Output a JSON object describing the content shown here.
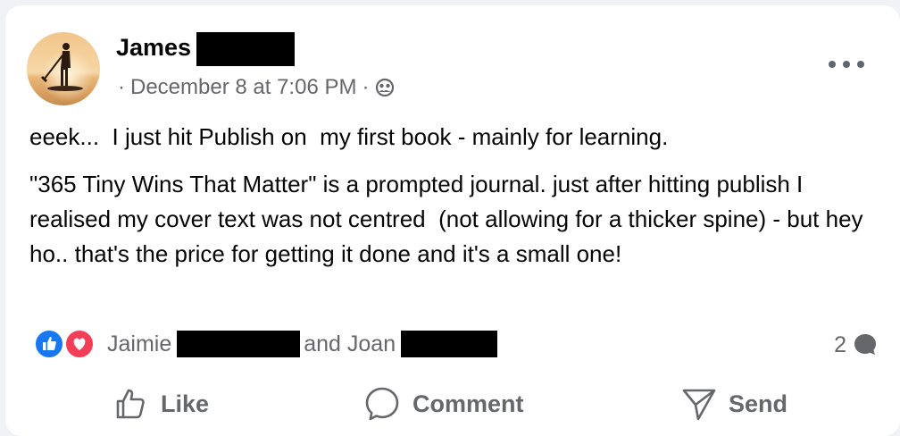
{
  "post": {
    "author": {
      "name": "James",
      "avatar": "avatar-paddleboard-sunset"
    },
    "meta": {
      "separator": "·",
      "date": "December 8 at 7:06 PM",
      "audience_icon": "friends-icon"
    },
    "more_icon": "more-options-icon",
    "body": {
      "paragraphs": [
        "eeek...  I just hit Publish on  my first book - mainly for learning.",
        "\"365 Tiny Wins That Matter\" is a prompted journal. just after hitting publish I realised my cover text was not centred  (not allowing for a thicker spine) - but hey ho.. that's the price for getting it done and it's a small one!"
      ]
    },
    "reactions": {
      "icons": [
        "like-icon",
        "love-icon"
      ],
      "name1": "Jaimie",
      "and_text": "and Joan"
    },
    "comments": {
      "count": "2",
      "icon": "comment-bubble-icon"
    }
  },
  "actions": {
    "like": {
      "label": "Like",
      "icon": "thumbs-up-icon"
    },
    "comment": {
      "label": "Comment",
      "icon": "comment-icon"
    },
    "send": {
      "label": "Send",
      "icon": "send-icon"
    }
  },
  "colors": {
    "text_primary": "#050505",
    "text_secondary": "#65676b",
    "like_blue": "#1877f2",
    "love_red": "#f33e58",
    "redaction": "#000000"
  }
}
